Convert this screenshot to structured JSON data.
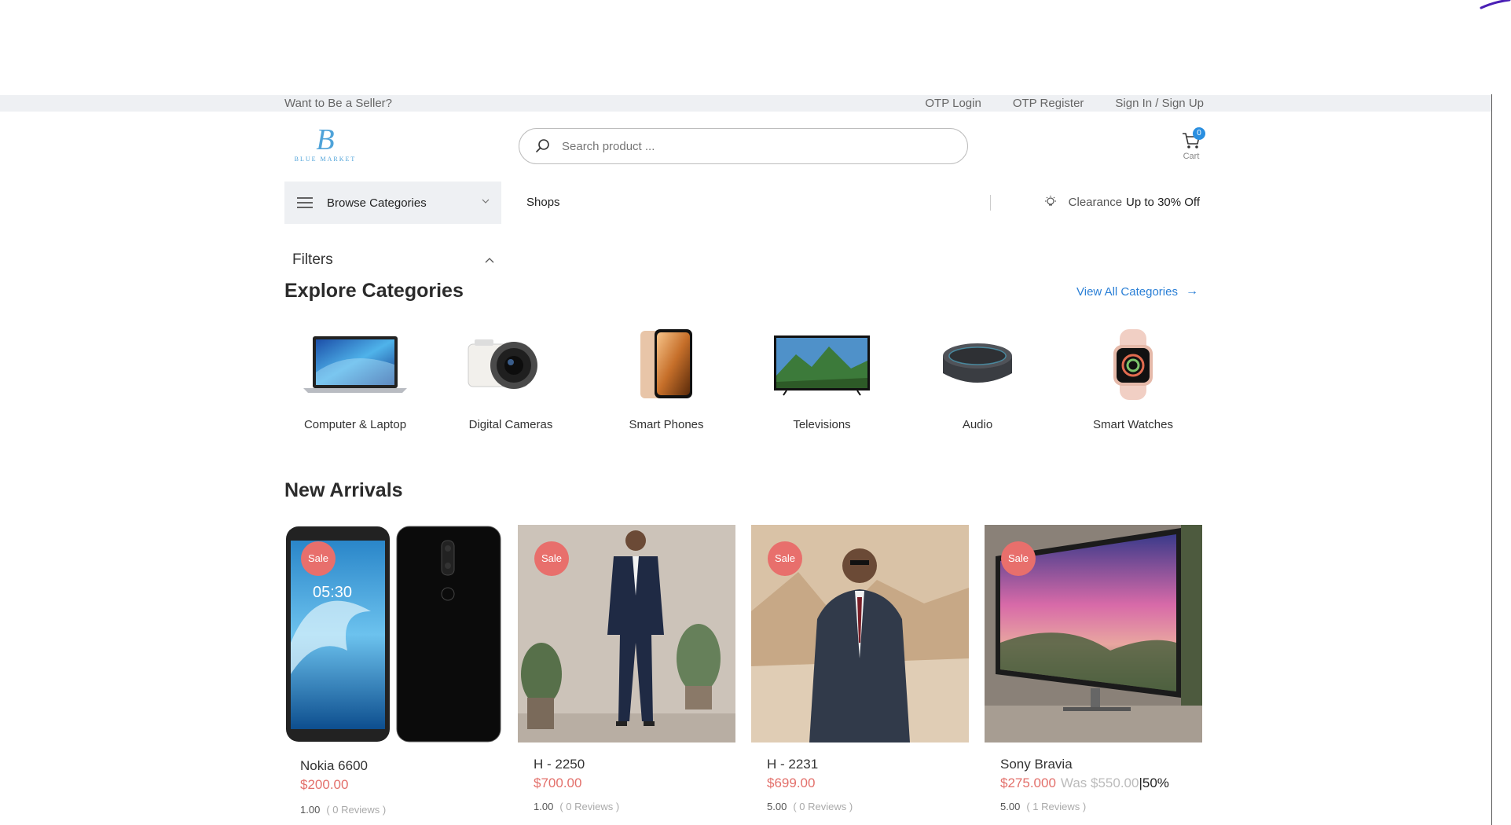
{
  "topbar": {
    "seller_link": "Want to Be a Seller?",
    "otp_login": "OTP Login",
    "otp_register": "OTP Register",
    "sign_in": "Sign In / Sign Up"
  },
  "header": {
    "logo_letter": "B",
    "logo_text": "BLUE MARKET",
    "search_placeholder": "Search product ...",
    "cart_count": "0",
    "cart_label": "Cart"
  },
  "nav": {
    "browse_label": "Browse Categories",
    "shops_label": "Shops",
    "clearance_label": "Clearance",
    "clearance_offer": "Up to 30% Off"
  },
  "filters": {
    "label": "Filters"
  },
  "explore": {
    "title": "Explore Categories",
    "view_all": "View All Categories",
    "categories": [
      {
        "name": "Computer & Laptop",
        "icon": "laptop-icon"
      },
      {
        "name": "Digital Cameras",
        "icon": "camera-icon"
      },
      {
        "name": "Smart Phones",
        "icon": "smartphone-icon"
      },
      {
        "name": "Televisions",
        "icon": "television-icon"
      },
      {
        "name": "Audio",
        "icon": "smart-speaker-icon"
      },
      {
        "name": "Smart Watches",
        "icon": "smartwatch-icon"
      }
    ]
  },
  "arrivals": {
    "title": "New Arrivals",
    "products": [
      {
        "badge": "Sale",
        "name": "Nokia 6600",
        "price": "$200.00",
        "rating": "1.00",
        "reviews": "( 0 Reviews )"
      },
      {
        "badge": "Sale",
        "name": "H - 2250",
        "price": "$700.00",
        "rating": "1.00",
        "reviews": "( 0 Reviews )"
      },
      {
        "badge": "Sale",
        "name": "H - 2231",
        "price": "$699.00",
        "rating": "5.00",
        "reviews": "( 0 Reviews )"
      },
      {
        "badge": "Sale",
        "name": "Sony Bravia",
        "price": "$275.000",
        "was": "Was $550.00",
        "discount": "|50%",
        "rating": "5.00",
        "reviews": "( 1 Reviews )"
      }
    ]
  },
  "colors": {
    "accent": "#2a7fd6",
    "sale": "#e86f6c",
    "topbar_bg": "#eef0f3"
  }
}
